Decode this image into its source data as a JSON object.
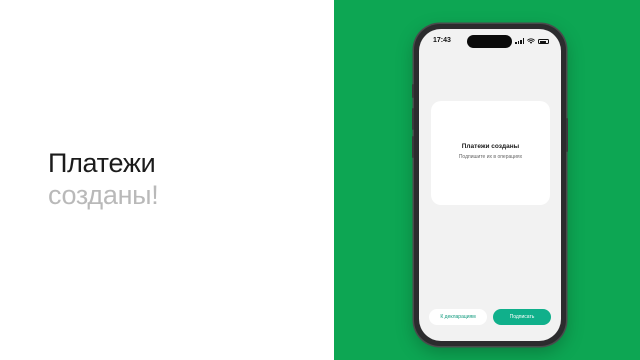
{
  "headline": {
    "line1": "Платежи",
    "line2": "созданы!"
  },
  "phone": {
    "status_bar": {
      "time": "17:43",
      "icons": [
        "cellular-signal-icon",
        "wifi-icon",
        "battery-icon"
      ],
      "battery_level": 0.8
    },
    "card": {
      "title": "Платежи созданы",
      "subtitle": "Подпишите их в операциях"
    },
    "buttons": {
      "secondary_label": "К декларациям",
      "primary_label": "Подписать"
    }
  },
  "colors": {
    "background_right": "#0da653",
    "headline_primary": "#1b1b1b",
    "headline_secondary": "#b9b9b9",
    "button_primary": "#10b08b",
    "button_secondary_text": "#0f9a7d",
    "screen_background": "#f2f2f2"
  }
}
